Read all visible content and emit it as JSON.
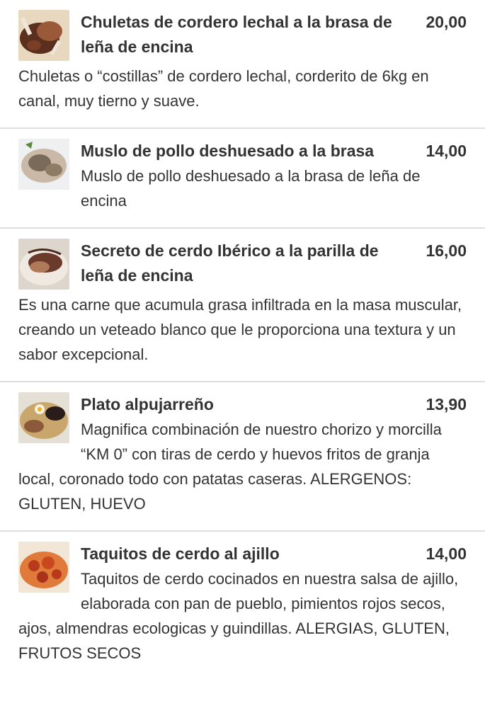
{
  "menu": {
    "items": [
      {
        "name": "Chuletas de cordero lechal a la brasa de leña de encina",
        "price": "20,00",
        "description": "Chuletas o “costillas” de cordero lechal, corderito de 6kg en canal, muy tierno y suave.",
        "image_icon": "lamb-chops-photo",
        "colors": {
          "a": "#5a2f1e",
          "b": "#9a5a3a",
          "c": "#e8d8c0"
        }
      },
      {
        "name": "Muslo de pollo deshuesado a la brasa",
        "price": "14,00",
        "description": "Muslo de pollo deshuesado a la brasa de leña de encina",
        "image_icon": "chicken-thigh-photo",
        "colors": {
          "a": "#7a6a5a",
          "b": "#c9b9a6",
          "c": "#eef0f2"
        }
      },
      {
        "name": "Secreto de cerdo Ibérico a la parilla de leña de encina",
        "price": "16,00",
        "description": "Es una carne que acumula grasa infiltrada en la masa muscular, creando un veteado blanco que le proporciona una textura y un sabor excepcional.",
        "image_icon": "iberian-pork-photo",
        "colors": {
          "a": "#6b3a2a",
          "b": "#b07a5a",
          "c": "#ddd6cc"
        }
      },
      {
        "name": "Plato alpujarreño",
        "price": "13,90",
        "description": "Magnifica combinación de nuestro chorizo y morcilla “KM 0” con tiras de cerdo y huevos fritos de granja local, coronado todo con patatas caseras. ALERGENOS: GLUTEN, HUEVO",
        "image_icon": "plato-alpujarreno-photo",
        "colors": {
          "a": "#2a1c1a",
          "b": "#c9a66b",
          "c": "#e5e0d6"
        }
      },
      {
        "name": "Taquitos de cerdo al ajillo",
        "price": "14,00",
        "description": "Taquitos de cerdo cocinados en nuestra salsa de ajillo, elaborada con pan de pueblo, pimientos rojos secos, ajos, almendras ecologicas y guindillas. ALERGIAS, GLUTEN, FRUTOS SECOS",
        "image_icon": "garlic-pork-photo",
        "colors": {
          "a": "#b83a1a",
          "b": "#e07a3a",
          "c": "#f2e6d6"
        }
      }
    ]
  }
}
